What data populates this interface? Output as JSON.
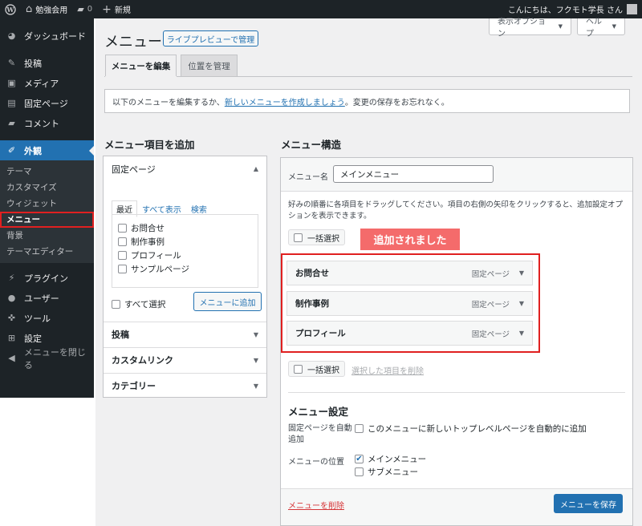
{
  "adminbar": {
    "site_name": "勉強会用",
    "comment_count": "0",
    "new_label": "新規",
    "greeting": "こんにちは、フクモト学長 さん"
  },
  "sidebar": {
    "dashboard": "ダッシュボード",
    "posts": "投稿",
    "media": "メディア",
    "pages": "固定ページ",
    "comments": "コメント",
    "appearance": "外観",
    "sub": [
      "テーマ",
      "カスタマイズ",
      "ウィジェット",
      "メニュー",
      "背景",
      "テーマエディター"
    ],
    "plugins": "プラグイン",
    "users": "ユーザー",
    "tools": "ツール",
    "settings": "設定",
    "collapse": "メニューを閉じる"
  },
  "screen": {
    "options": "表示オプション",
    "help": "ヘルプ"
  },
  "page": {
    "title": "メニュー",
    "live_preview": "ライブプレビューで管理",
    "tab_edit": "メニューを編集",
    "tab_locations": "位置を管理",
    "notice_before": "以下のメニューを編集するか、",
    "notice_link": "新しいメニューを作成しましょう",
    "notice_after": "。変更の保存をお忘れなく。"
  },
  "add_items": {
    "heading": "メニュー項目を追加",
    "pages_section": "固定ページ",
    "tabs": [
      "最近",
      "すべて表示",
      "検索"
    ],
    "pages": [
      "お問合せ",
      "制作事例",
      "プロフィール",
      "サンプルページ"
    ],
    "select_all": "すべて選択",
    "add_button": "メニューに追加",
    "sections": [
      "投稿",
      "カスタムリンク",
      "カテゴリー"
    ]
  },
  "structure": {
    "heading": "メニュー構造",
    "name_label": "メニュー名",
    "name_value": "メインメニュー",
    "instructions": "好みの順番に各項目をドラッグしてください。項目の右側の矢印をクリックすると、追加設定オプションを表示できます。",
    "bulk_select": "一括選択",
    "added_badge": "追加されました",
    "items": [
      {
        "title": "お問合せ",
        "type": "固定ページ"
      },
      {
        "title": "制作事例",
        "type": "固定ページ"
      },
      {
        "title": "プロフィール",
        "type": "固定ページ"
      }
    ],
    "remove_selected": "選択した項目を削除"
  },
  "settings": {
    "heading": "メニュー設定",
    "auto_add_label": "固定ページを自動追加",
    "auto_add_option": "このメニューに新しいトップレベルページを自動的に追加",
    "location_label": "メニューの位置",
    "locations": [
      {
        "label": "メインメニュー",
        "checked": true
      },
      {
        "label": "サブメニュー",
        "checked": false
      }
    ],
    "delete_link": "メニューを削除",
    "save_button": "メニューを保存"
  },
  "colors": {
    "accent": "#2271b1",
    "highlight_red": "#e02020",
    "badge": "#f46b6b",
    "admin_dark": "#1d2327"
  }
}
